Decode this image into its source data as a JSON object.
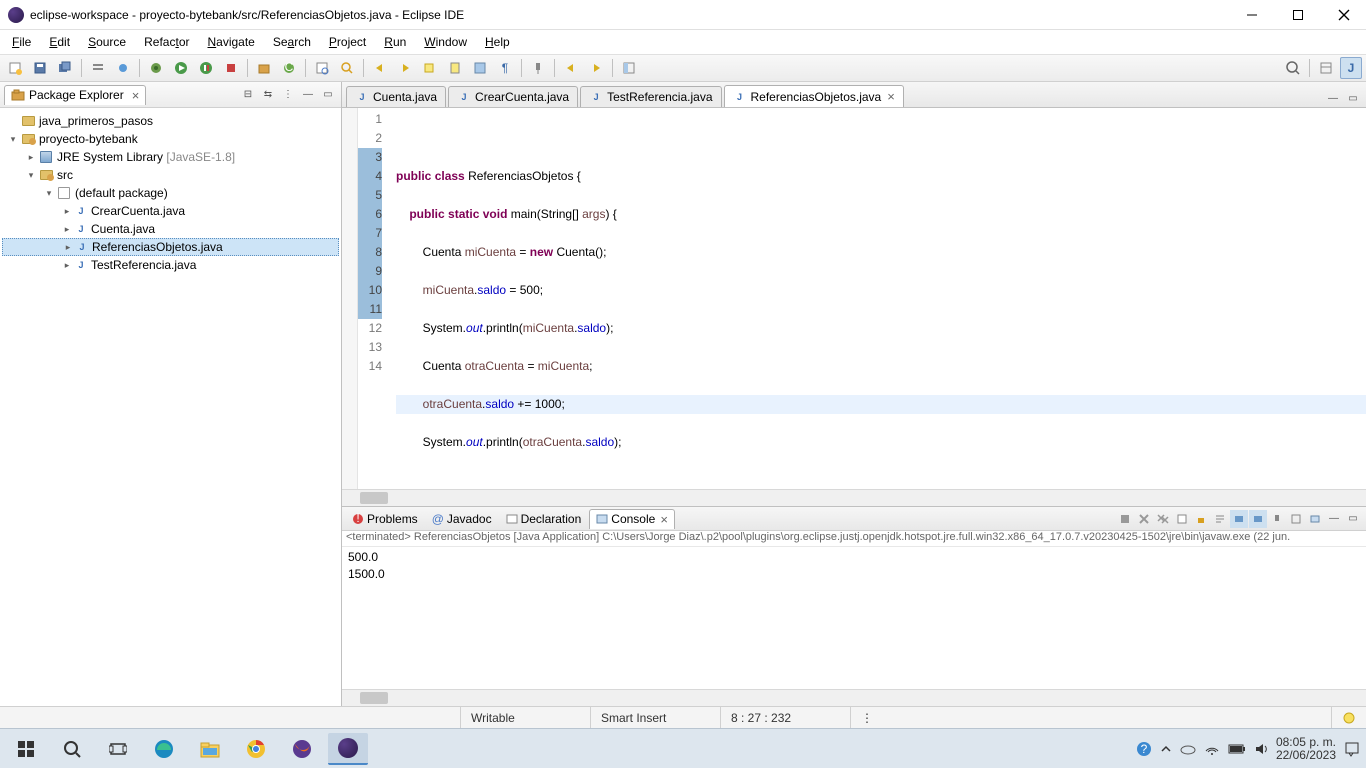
{
  "window": {
    "title": "eclipse-workspace - proyecto-bytebank/src/ReferenciasObjetos.java - Eclipse IDE"
  },
  "menubar": [
    "File",
    "Edit",
    "Source",
    "Refactor",
    "Navigate",
    "Search",
    "Project",
    "Run",
    "Window",
    "Help"
  ],
  "package_explorer": {
    "title": "Package Explorer",
    "nodes": {
      "proj1": "java_primeros_pasos",
      "proj2": "proyecto-bytebank",
      "jre": "JRE System Library",
      "jre_ver": "[JavaSE-1.8]",
      "src": "src",
      "pkg": "(default package)",
      "f1": "CrearCuenta.java",
      "f2": "Cuenta.java",
      "f3": "ReferenciasObjetos.java",
      "f4": "TestReferencia.java"
    }
  },
  "editor_tabs": {
    "t1": "Cuenta.java",
    "t2": "CrearCuenta.java",
    "t3": "TestReferencia.java",
    "t4": "ReferenciasObjetos.java"
  },
  "code": {
    "l2a": "public",
    "l2b": "class",
    "l2c": "ReferenciasObjetos {",
    "l3a": "public",
    "l3b": "static",
    "l3c": "void",
    "l3d": "main(String[]",
    "l3e": "args",
    "l3f": ") {",
    "l4a": "Cuenta",
    "l4b": "miCuenta",
    "l4c": "=",
    "l4d": "new",
    "l4e": "Cuenta();",
    "l5a": "miCuenta",
    "l5b": ".",
    "l5c": "saldo",
    "l5d": " = 500;",
    "l6a": "System.",
    "l6b": "out",
    "l6c": ".println(",
    "l6d": "miCuenta",
    "l6e": ".",
    "l6f": "saldo",
    "l6g": ");",
    "l7a": "Cuenta",
    "l7b": "otraCuenta",
    "l7c": "=",
    "l7d": "miCuenta",
    "l7e": ";",
    "l8a": "otraCuenta",
    "l8b": ".",
    "l8c": "saldo",
    "l8d": " += 1000;",
    "l9a": "System.",
    "l9b": "out",
    "l9c": ".println(",
    "l9d": "otraCuenta",
    "l9e": ".",
    "l9f": "saldo",
    "l9g": ");",
    "l11": "}",
    "l13": "}"
  },
  "gutter": [
    "1",
    "2",
    "3",
    "4",
    "5",
    "6",
    "7",
    "8",
    "9",
    "10",
    "11",
    "12",
    "13",
    "14"
  ],
  "bottom_tabs": {
    "problems": "Problems",
    "javadoc": "Javadoc",
    "declaration": "Declaration",
    "console": "Console"
  },
  "console": {
    "status": "<terminated> ReferenciasObjetos [Java Application] C:\\Users\\Jorge Diaz\\.p2\\pool\\plugins\\org.eclipse.justj.openjdk.hotspot.jre.full.win32.x86_64_17.0.7.v20230425-1502\\jre\\bin\\javaw.exe  (22 jun.",
    "out1": "500.0",
    "out2": "1500.0"
  },
  "statusbar": {
    "writable": "Writable",
    "insert": "Smart Insert",
    "pos": "8 : 27 : 232"
  },
  "tray": {
    "time": "08:05 p. m.",
    "date": "22/06/2023"
  }
}
